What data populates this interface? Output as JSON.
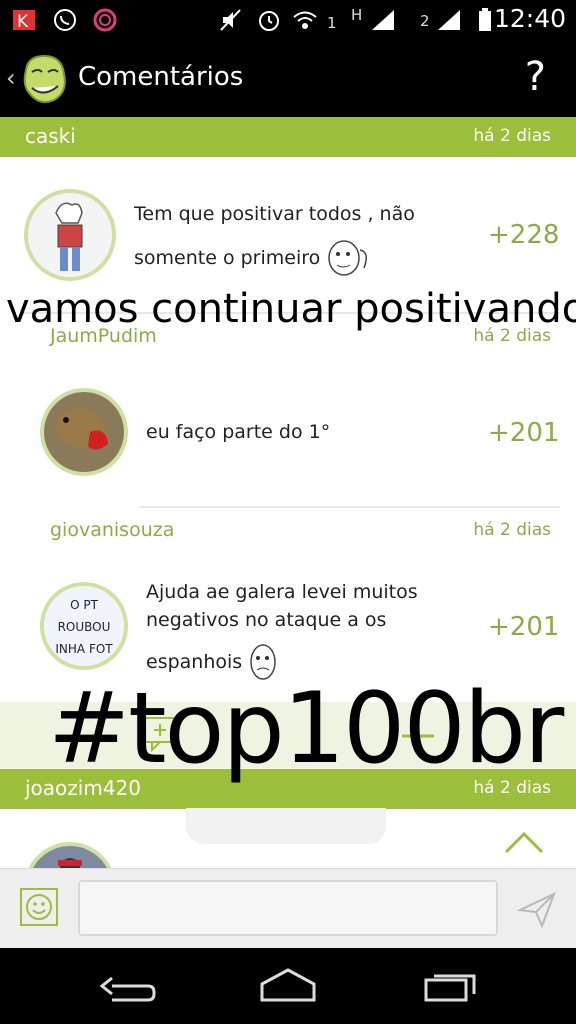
{
  "status_bar": {
    "time": "12:40",
    "sim1_label": "1",
    "h_label": "H",
    "sim2_label": "2"
  },
  "app_bar": {
    "title": "Comentários",
    "help_label": "?"
  },
  "comments": [
    {
      "user": "caski",
      "ago": "há 2 dias",
      "text_line1": "Tem que positivar todos , não",
      "text_line2": "somente o primeiro",
      "score": "+228"
    },
    {
      "user": "JaumPudim",
      "ago": "há 2 dias",
      "text_line1": "eu faço parte do 1°",
      "score": "+201"
    },
    {
      "user": "giovanisouza",
      "ago": "há 2 dias",
      "text_line1": "Ajuda ae galera levei muitos",
      "text_line2": "negativos no ataque a os",
      "text_line3": "espanhois",
      "score": "+201",
      "avatar_text": [
        "O PT",
        "ROUBOU",
        "INHA FOT"
      ]
    },
    {
      "user": "joaozim420",
      "ago": "há 2 dias"
    }
  ],
  "overlay": {
    "line": "vamos continuar positivando",
    "hashtag": "#top100br"
  },
  "icons": {
    "app_logo": "trollface-logo-icon",
    "help": "question-mark-icon",
    "emoji": "smiley-icon",
    "send": "send-icon",
    "scroll_up": "chevron-up-icon",
    "nav_back": "back-icon",
    "nav_home": "home-icon",
    "nav_recent": "recent-apps-icon"
  },
  "colors": {
    "accent": "#9bbf3a",
    "score": "#8aab48"
  }
}
